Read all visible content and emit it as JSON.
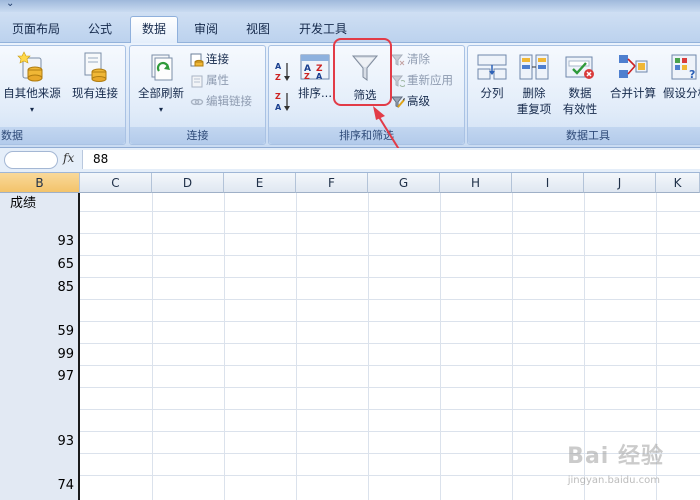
{
  "tabs": [
    {
      "label": "页面布局"
    },
    {
      "label": "公式"
    },
    {
      "label": "数据",
      "active": true
    },
    {
      "label": "审阅"
    },
    {
      "label": "视图"
    },
    {
      "label": "开发工具"
    }
  ],
  "ribbon": {
    "group_external": {
      "label": "数据",
      "btn_other_sources": "自其他来源",
      "btn_existing_conn": "现有连接"
    },
    "group_connections": {
      "label": "连接",
      "btn_refresh_all": "全部刷新",
      "link_connections": "连接",
      "link_properties": "属性",
      "link_edit_links": "编辑链接"
    },
    "group_sort_filter": {
      "label": "排序和筛选",
      "btn_sort": "排序...",
      "btn_filter": "筛选",
      "link_clear": "清除",
      "link_reapply": "重新应用",
      "link_advanced": "高级"
    },
    "group_data_tools": {
      "label": "数据工具",
      "btn_text_to_columns": "分列",
      "btn_remove_dup_1": "删除",
      "btn_remove_dup_2": "重复项",
      "btn_validation_1": "数据",
      "btn_validation_2": "有效性",
      "btn_consolidate": "合并计算",
      "btn_whatif": "假设分析"
    }
  },
  "formula_bar": {
    "fx": "fx",
    "value": "88"
  },
  "columns": [
    "B",
    "C",
    "D",
    "E",
    "F",
    "G",
    "H",
    "I",
    "J",
    "K"
  ],
  "cells_B": [
    {
      "text": "成绩",
      "type": "txt"
    },
    {
      "text": "",
      "type": "num"
    },
    {
      "text": "93",
      "type": "num"
    },
    {
      "text": "65",
      "type": "num"
    },
    {
      "text": "85",
      "type": "num"
    },
    {
      "text": "",
      "type": "num"
    },
    {
      "text": "59",
      "type": "num"
    },
    {
      "text": "99",
      "type": "num"
    },
    {
      "text": "97",
      "type": "num"
    },
    {
      "text": "",
      "type": "num"
    },
    {
      "text": "",
      "type": "num"
    },
    {
      "text": "93",
      "type": "num"
    },
    {
      "text": "",
      "type": "num"
    },
    {
      "text": "74",
      "type": "num"
    }
  ],
  "watermark": {
    "main": "Bai 经验",
    "sub": "jingyan.baidu.com"
  },
  "colors": {
    "accent": "#e23b47",
    "selected_header": "#f3c36a"
  }
}
